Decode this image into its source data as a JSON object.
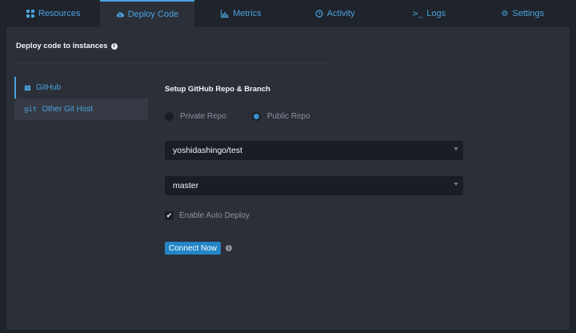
{
  "tabs": [
    {
      "label": "Resources",
      "icon": "grid-icon",
      "active": false
    },
    {
      "label": "Deploy Code",
      "icon": "cloud-upload-icon",
      "active": true
    },
    {
      "label": "Metrics",
      "icon": "bar-chart-icon",
      "active": false
    },
    {
      "label": "Activity",
      "icon": "clock-icon",
      "active": false
    },
    {
      "label": "Logs",
      "icon": "terminal-icon",
      "active": false
    },
    {
      "label": "Settings",
      "icon": "gear-icon",
      "active": false
    }
  ],
  "section": {
    "title": "Deploy code to instances"
  },
  "sidenav": {
    "items": [
      {
        "label": "GitHub",
        "icon": "github-icon",
        "active": true
      },
      {
        "label": "Other Git Host",
        "icon": "git-icon",
        "icon_text": "git",
        "active": false
      }
    ]
  },
  "form": {
    "title": "Setup GitHub Repo & Branch",
    "radios": [
      {
        "label": "Private Repo",
        "selected": false
      },
      {
        "label": "Public Repo",
        "selected": true
      }
    ],
    "repo_value": "yoshidashingo/test",
    "branch_value": "master",
    "auto_deploy_label": "Enable Auto Deploy",
    "auto_deploy_checked": true,
    "connect_button": "Connect Now"
  },
  "colors": {
    "accent": "#4aa3df",
    "button": "#2385c6",
    "background": "#2b2f38"
  }
}
